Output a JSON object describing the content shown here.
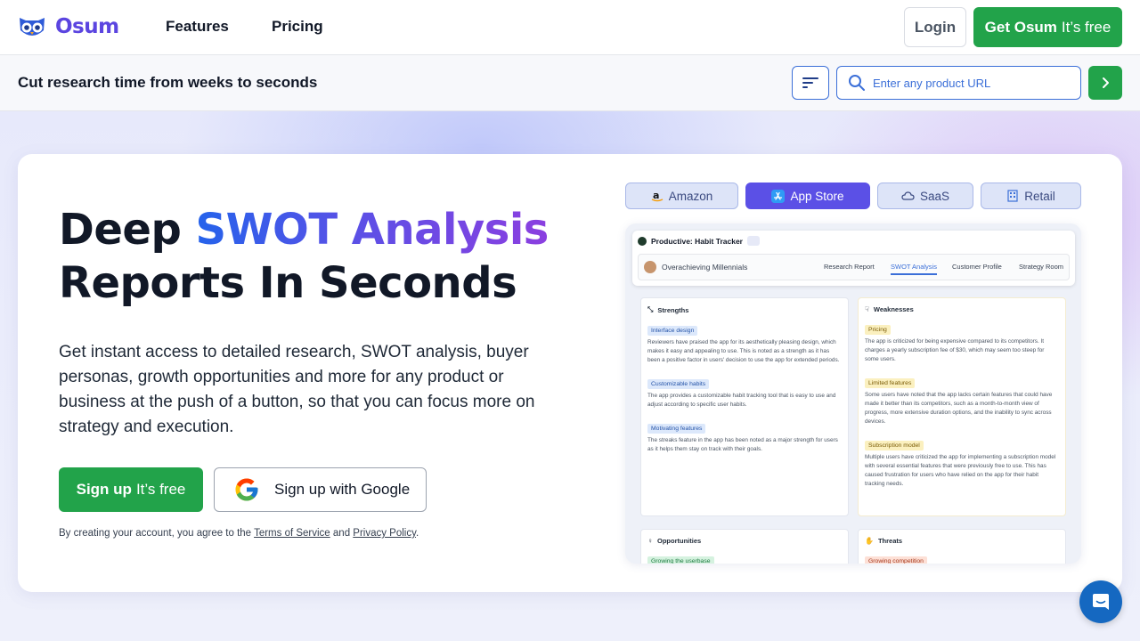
{
  "nav": {
    "brand": "Osum",
    "links": [
      "Features",
      "Pricing"
    ],
    "login": "Login",
    "cta_bold": "Get Osum",
    "cta_rest": "It’s free"
  },
  "subbar": {
    "title": "Cut research time from weeks to seconds",
    "url_placeholder": "Enter any product URL"
  },
  "hero": {
    "headline_1": "Deep ",
    "headline_highlight": "SWOT Analysis",
    "headline_2": "Reports In Seconds",
    "description": "Get instant access to detailed research, SWOT analysis, buyer personas, growth opportunities and more for any product or business at the push of a button, so that you can focus more on strategy and execution.",
    "signup_bold": "Sign up",
    "signup_rest": "It’s free",
    "google_signup": "Sign up with Google",
    "terms_prefix": "By creating your account, you agree to the ",
    "terms_link": "Terms of Service",
    "terms_and": " and ",
    "privacy_link": "Privacy Policy",
    "terms_suffix": "."
  },
  "source_tabs": [
    {
      "label": "Amazon",
      "icon": "amazon-icon",
      "active": false
    },
    {
      "label": "App Store",
      "icon": "app-store-icon",
      "active": true
    },
    {
      "label": "SaaS",
      "icon": "cloud-icon",
      "active": false
    },
    {
      "label": "Retail",
      "icon": "building-icon",
      "active": false
    }
  ],
  "preview": {
    "app_name": "Productive: Habit Tracker",
    "persona": "Overachieving Millennials",
    "tabs": [
      "Research Report",
      "SWOT Analysis",
      "Customer Profile",
      "Strategy Room"
    ],
    "selected_tab": "SWOT Analysis",
    "strengths": {
      "title": "Strengths",
      "items": [
        {
          "tag": "Interface design",
          "text": "Reviewers have praised the app for its aesthetically pleasing design, which makes it easy and appealing to use. This is noted as a strength as it has been a positive factor in users' decision to use the app for extended periods."
        },
        {
          "tag": "Customizable habits",
          "text": "The app provides a customizable habit tracking tool that is easy to use and adjust according to specific user habits."
        },
        {
          "tag": "Motivating features",
          "text": "The streaks feature in the app has been noted as a major strength for users as it helps them stay on track with their goals."
        }
      ]
    },
    "weaknesses": {
      "title": "Weaknesses",
      "items": [
        {
          "tag": "Pricing",
          "text": "The app is criticized for being expensive compared to its competitors. It charges a yearly subscription fee of $30, which may seem too steep for some users."
        },
        {
          "tag": "Limited features",
          "text": "Some users have noted that the app lacks certain features that could have made it better than its competitors, such as a month-to-month view of progress, more extensive duration options, and the inability to sync across devices."
        },
        {
          "tag": "Subscription model",
          "text": "Multiple users have criticized the app for implementing a subscription model with several essential features that were previously free to use. This has caused frustration for users who have relied on the app for their habit tracking needs."
        }
      ]
    },
    "opportunities": {
      "title": "Opportunities",
      "tag": "Growing the userbase"
    },
    "threats": {
      "title": "Threats",
      "tag": "Growing competition"
    }
  },
  "colors": {
    "brand": "#5b45e0",
    "cta_green": "#22a34a",
    "accent_blue": "#3b6fd8",
    "tab_active": "#5b50e6",
    "chat": "#1568c1"
  }
}
